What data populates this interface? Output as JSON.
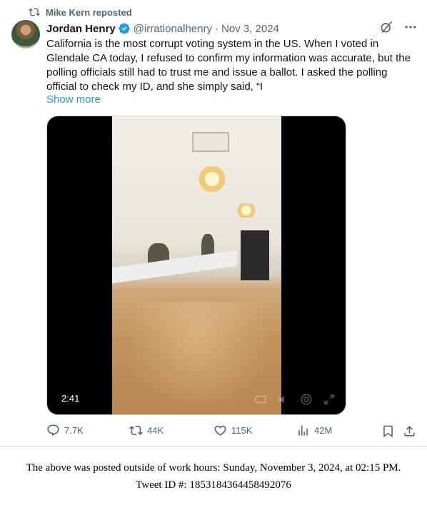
{
  "repost": {
    "text": "Mike Kern reposted",
    "icon": "repost-icon"
  },
  "author": {
    "name": "Jordan Henry",
    "handle": "@irrationalhenry",
    "separator": "·",
    "date": "Nov 3, 2024",
    "verified_color": "#1d9bf0"
  },
  "tweet": {
    "text": "California is the most corrupt voting system in the US. When I voted in Glendale CA today, I refused to confirm my information was accurate, but the polling officials still had to trust me and issue a ballot. I asked the polling official to check my ID, and she simply said, “I",
    "show_more": "Show more"
  },
  "media": {
    "duration": "2:41"
  },
  "actions": {
    "replies": "7.7K",
    "reposts": "44K",
    "likes": "115K",
    "views": "42M"
  },
  "footer": {
    "line1": "The above was posted outside of work hours: Sunday, November 3, 2024, at 02:15 PM.",
    "line2": "Tweet ID #: 1853184364458492076"
  },
  "colors": {
    "link": "#1d9bf0",
    "muted": "#536471",
    "text": "#0f1419"
  }
}
